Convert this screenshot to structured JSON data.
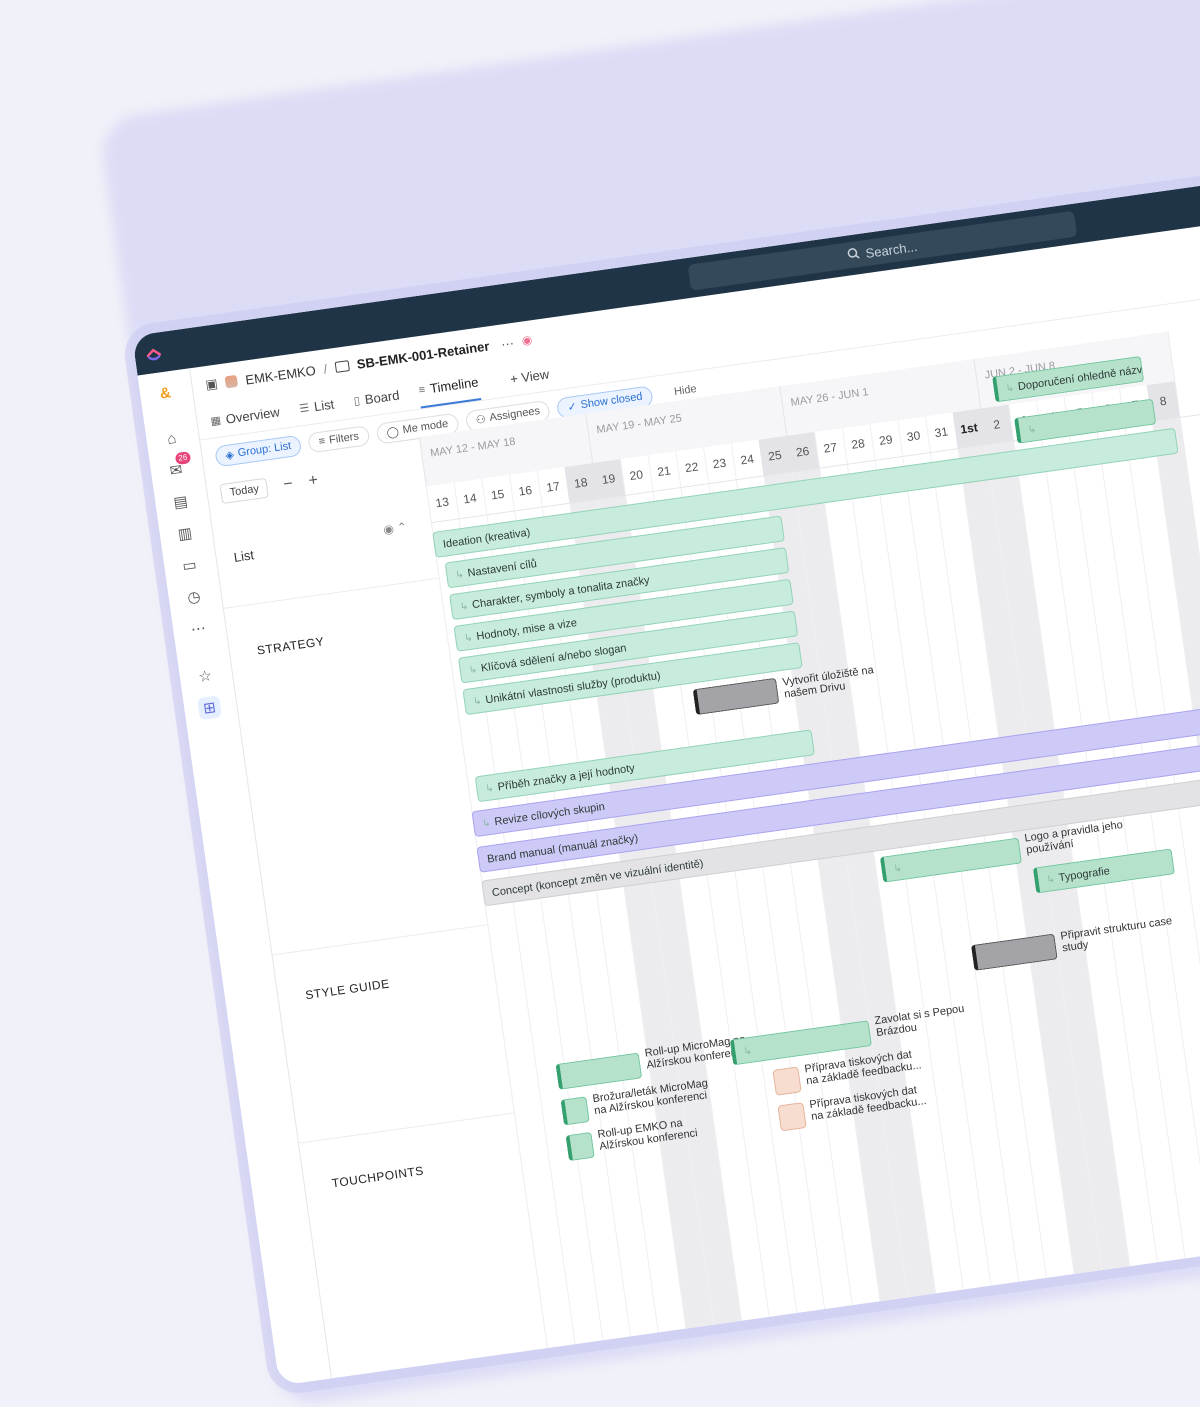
{
  "topbar": {
    "search_placeholder": "Search..."
  },
  "sidebar": {
    "inbox_badge": "26",
    "workspace_initial": "&"
  },
  "breadcrumb": {
    "space": "EMK-EMKO",
    "separator": "/",
    "folder": "SB-EMK-001-Retainer",
    "more": "···"
  },
  "tabs": [
    {
      "label": "Overview"
    },
    {
      "label": "List"
    },
    {
      "label": "Board"
    },
    {
      "label": "Timeline"
    },
    {
      "label": "+ View"
    }
  ],
  "filters": {
    "group": "Group: List",
    "filters": "Filters",
    "me_mode": "Me mode",
    "assignees": "Assignees",
    "show_closed": "Show closed",
    "hide": "Hide"
  },
  "controls": {
    "today": "Today",
    "minus": "−",
    "plus": "+"
  },
  "list": {
    "title": "List",
    "groups": [
      "STRATEGY",
      "STYLE GUIDE",
      "TOUCHPOINTS"
    ]
  },
  "timeline": {
    "weeks": [
      "MAY 12 - MAY 18",
      "MAY 19 - MAY 25",
      "MAY 26 - JUN 1",
      "JUN 2 - JUN 8"
    ],
    "days": [
      "13",
      "14",
      "15",
      "16",
      "17",
      "18",
      "19",
      "20",
      "21",
      "22",
      "23",
      "24",
      "25",
      "26",
      "27",
      "28",
      "29",
      "30",
      "31",
      "1st",
      "2",
      "3",
      "4",
      "5",
      "6",
      "7",
      "8"
    ],
    "tasks": [
      {
        "label": "Ideation (kreativa)"
      },
      {
        "label": "Nastavení cílů"
      },
      {
        "label": "Charakter, symboly a tonalita značky"
      },
      {
        "label": "Hodnoty, mise a vize"
      },
      {
        "label": "Klíčová sdělení a/nebo slogan"
      },
      {
        "label": "Unikátní vlastnosti služby (produktu)"
      },
      {
        "label": "Vytvořit úložiště na našem Drivu"
      },
      {
        "label": "Příběh značky a její hodnoty"
      },
      {
        "label": "Revize cílových skupin"
      },
      {
        "label": "Brand manual (manuál značky)"
      },
      {
        "label": "Concept (koncept změn ve vizuální identitě)"
      },
      {
        "label": "Logo a pravidla jeho používání"
      },
      {
        "label": "Typografie"
      },
      {
        "label": "Připravit strukturu case study"
      },
      {
        "label": "Doporučení ohledně názvu"
      },
      {
        "label": "Roll-up MicroMag na Alžírskou konferenci"
      },
      {
        "label": "Brožura/leták MicroMag na Alžírskou konferenci"
      },
      {
        "label": "Roll-up EMKO na Alžírskou konferenci"
      },
      {
        "label": "Zavolat si s Pepou Brázdou"
      },
      {
        "label": "Příprava tiskových dat na základě feedbacku..."
      },
      {
        "label": "Příprava tiskových dat na základě feedbacku..."
      }
    ]
  }
}
